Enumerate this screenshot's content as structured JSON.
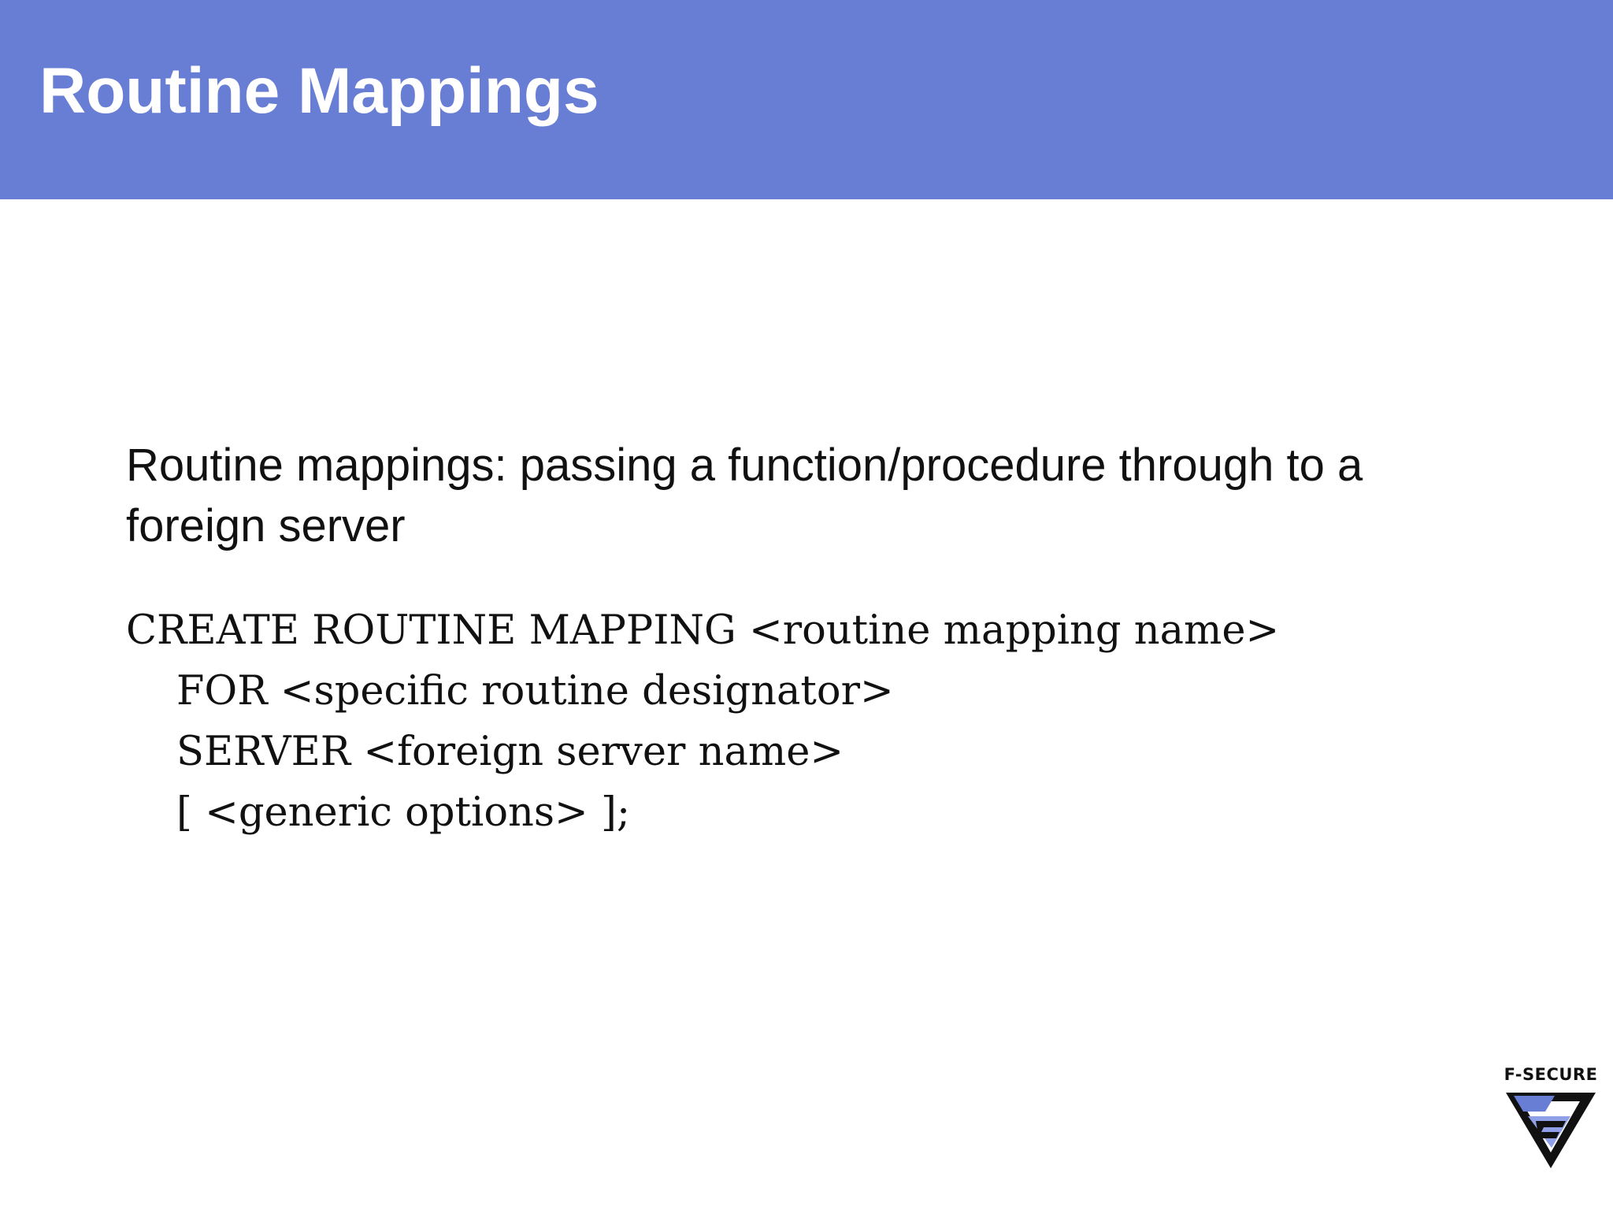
{
  "slide": {
    "title": "Routine Mappings",
    "intro": "Routine mappings: passing a function/procedure through to a foreign server",
    "code": [
      "CREATE ROUTINE MAPPING <routine mapping name>",
      "FOR <specific routine designator>",
      "SERVER <foreign server name>",
      "[ <generic options> ];"
    ]
  },
  "logo": {
    "text": "F-SECURE",
    "icon": "f-secure-logo-icon"
  },
  "colors": {
    "header_background": "#687dd4",
    "body_text": "#111111",
    "background": "#ffffff"
  }
}
